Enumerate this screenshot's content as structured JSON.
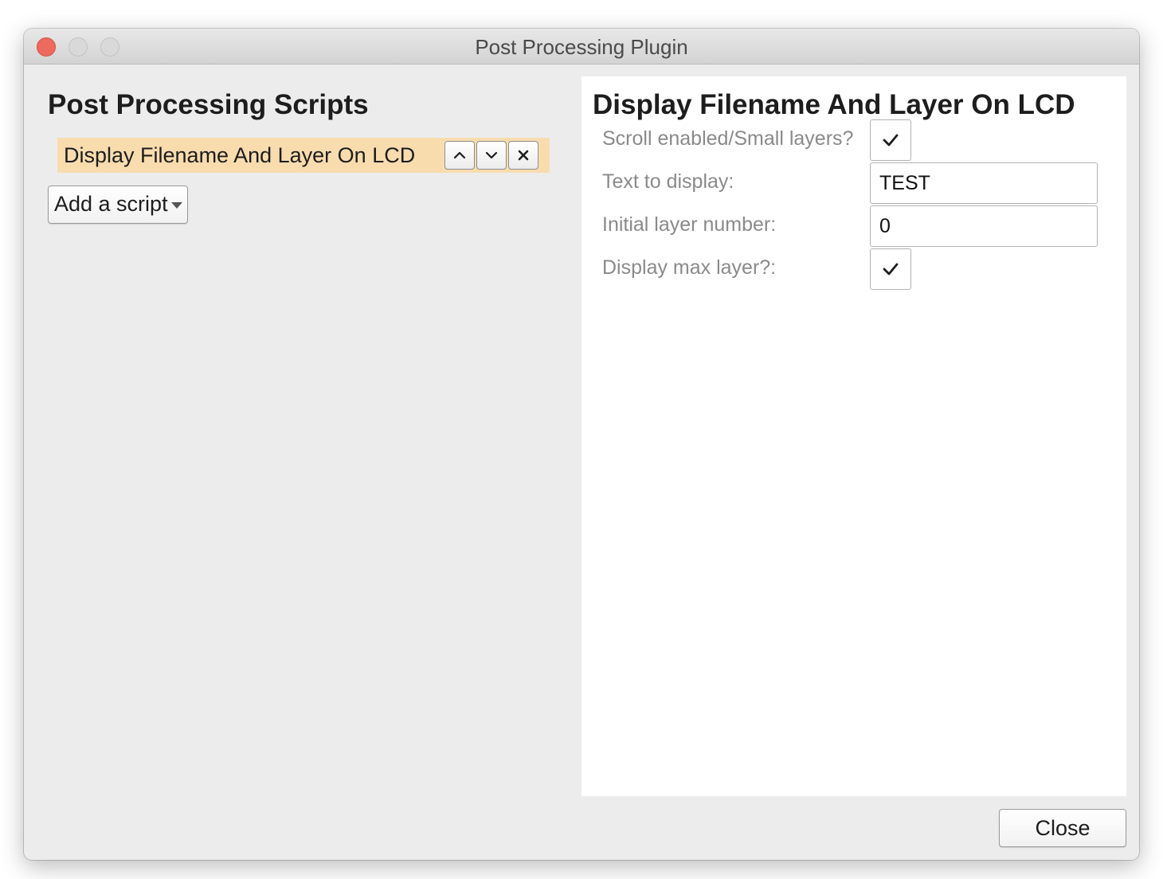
{
  "window": {
    "title": "Post Processing Plugin"
  },
  "left_panel": {
    "title": "Post Processing Scripts",
    "scripts": [
      {
        "label": "Display Filename And Layer On LCD"
      }
    ],
    "add_script_label": "Add a script"
  },
  "right_panel": {
    "title": "Display Filename And Layer On LCD",
    "settings": {
      "scroll_enabled": {
        "label": "Scroll enabled/Small layers?",
        "checked": true
      },
      "text_to_display": {
        "label": "Text to display:",
        "value": "TEST"
      },
      "initial_layer_number": {
        "label": "Initial layer number:",
        "value": "0"
      },
      "display_max_layer": {
        "label": "Display max layer?:",
        "checked": true
      }
    }
  },
  "footer": {
    "close_label": "Close"
  },
  "icons": {
    "move_up": "chevron-up-icon",
    "move_down": "chevron-down-icon",
    "remove": "close-icon",
    "dropdown": "caret-down-icon",
    "check": "checkmark-icon"
  },
  "colors": {
    "selected_item_bg": "#f9dcae",
    "close_traffic_light": "#ed6a5e",
    "window_bg": "#ececec",
    "settings_panel_bg": "#ffffff"
  }
}
